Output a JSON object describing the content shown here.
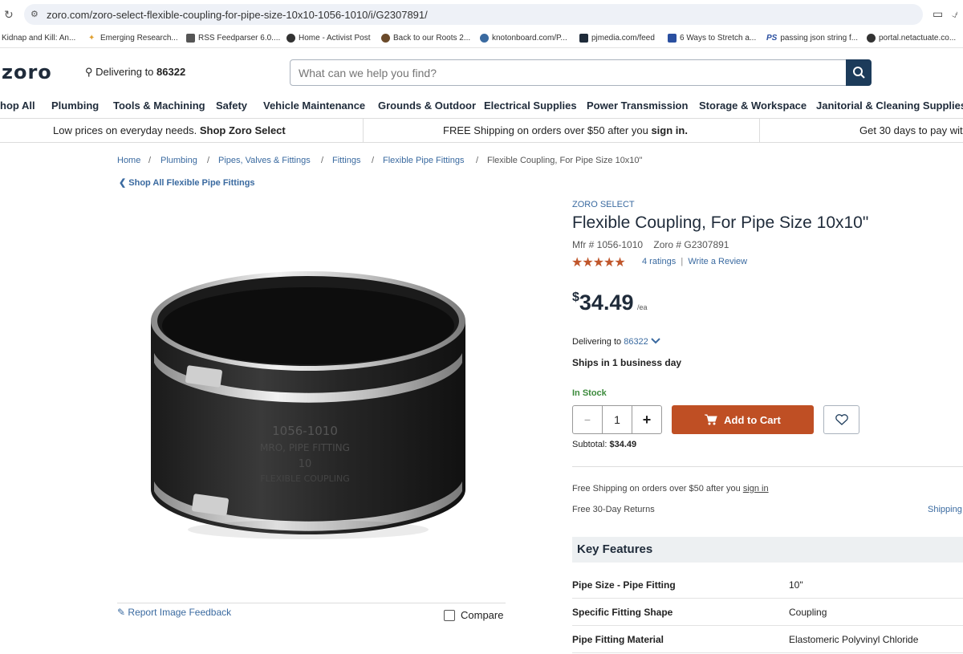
{
  "browser": {
    "url": "zoro.com/zoro-select-flexible-coupling-for-pipe-size-10x10-1056-1010/i/G2307891/",
    "bookmarks": [
      "Kidnap and Kill: An...",
      "Emerging Research...",
      "RSS Feedparser 6.0....",
      "Home - Activist Post",
      "Back to our Roots 2...",
      "knotonboard.com/P...",
      "pjmedia.com/feed",
      "6 Ways to Stretch a...",
      "passing json string f...",
      "portal.netactuate.co..."
    ]
  },
  "header": {
    "logo": "zoro",
    "delivering_label": "Delivering to",
    "zip": "86322",
    "search_placeholder": "What can we help you find?"
  },
  "nav": [
    "hop All",
    "Plumbing",
    "Tools & Machining",
    "Safety",
    "Vehicle Maintenance",
    "Grounds & Outdoor",
    "Electrical Supplies",
    "Power Transmission",
    "Storage & Workspace",
    "Janitorial & Cleaning Supplies"
  ],
  "promo": {
    "p1_text": "Low prices on everyday needs.",
    "p1_link": "Shop Zoro Select",
    "p2_text": "FREE Shipping on orders over $50 after you",
    "p2_link": "sign in.",
    "p3_text": "Get 30 days to pay wit"
  },
  "breadcrumb": [
    "Home",
    "Plumbing",
    "Pipes, Valves & Fittings",
    "Fittings",
    "Flexible Pipe Fittings",
    "Flexible Coupling, For Pipe Size 10x10\""
  ],
  "back_link": "Shop All Flexible Pipe Fittings",
  "image_section": {
    "stamp_line1": "1056-1010",
    "stamp_line2": "MRO, PIPE FITTING",
    "stamp_line3": "10",
    "stamp_line4": "FLEXIBLE COUPLING",
    "feedback": "Report Image Feedback",
    "compare": "Compare"
  },
  "product": {
    "brand": "ZORO SELECT",
    "title": "Flexible Coupling, For Pipe Size 10x10\"",
    "mfr": "Mfr # 1056-1010",
    "zoro_no": "Zoro # G2307891",
    "stars": "★★★★★",
    "rating_value": 5,
    "ratings": "4 ratings",
    "write_review": "Write a Review",
    "price_currency": "$",
    "price_amount": "34.49",
    "price_unit": "/ea",
    "delivering_label": "Delivering to",
    "zip": "86322",
    "ships": "Ships in 1 business day",
    "stock": "In Stock",
    "qty": "1",
    "add_to_cart": "Add to Cart",
    "subtotal_label": "Subtotal:",
    "subtotal_value": "$34.49",
    "free_ship_text": "Free Shipping on orders over $50 after you",
    "free_ship_link": "sign in",
    "returns": "Free 30-Day Returns",
    "shipping_link": "Shipping"
  },
  "key_features": {
    "title": "Key Features",
    "rows": [
      {
        "label": "Pipe Size - Pipe Fitting",
        "value": "10\""
      },
      {
        "label": "Specific Fitting Shape",
        "value": "Coupling"
      },
      {
        "label": "Pipe Fitting Material",
        "value": "Elastomeric Polyvinyl Chloride"
      }
    ]
  },
  "colors": {
    "accent": "#bf4f24",
    "link": "#3a6aa0",
    "brand_dark": "#1c3b5a",
    "in_stock": "#3b8a3b"
  }
}
